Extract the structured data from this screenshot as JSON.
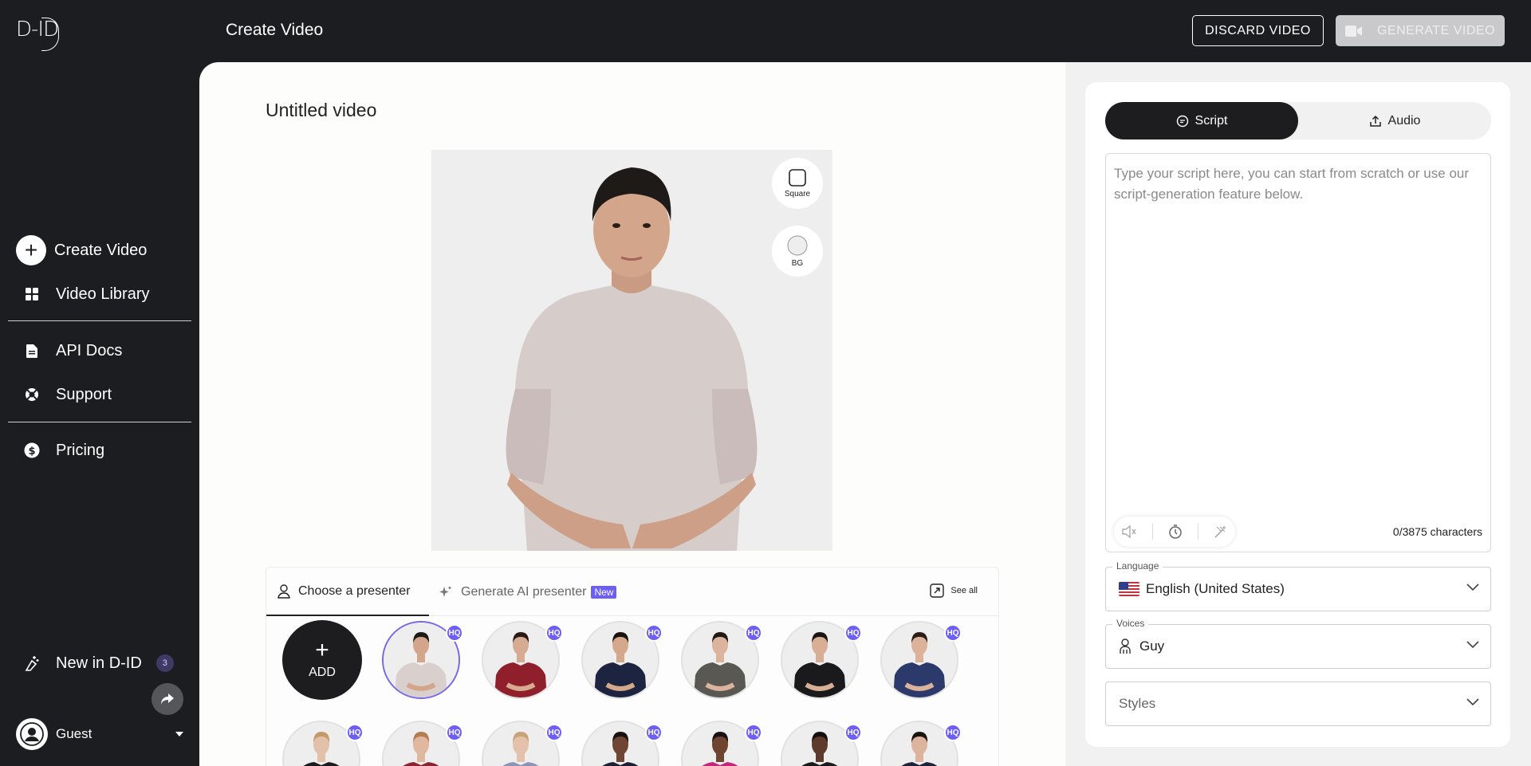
{
  "app": {
    "logo_text": "D-ID",
    "page_title": "Create Video"
  },
  "sidebar": {
    "items": [
      {
        "label": "Create Video",
        "icon": "plus-circle-icon"
      },
      {
        "label": "Video Library",
        "icon": "grid-icon"
      },
      {
        "label": "API Docs",
        "icon": "document-icon"
      },
      {
        "label": "Support",
        "icon": "lifebuoy-icon"
      },
      {
        "label": "Pricing",
        "icon": "dollar-icon"
      }
    ],
    "new_in": {
      "label": "New in D-ID",
      "count": "3"
    },
    "user": {
      "name": "Guest"
    }
  },
  "header": {
    "discard_label": "DISCARD VIDEO",
    "generate_label": "GENERATE VIDEO"
  },
  "editor": {
    "video_title": "Untitled video",
    "preview_controls": {
      "square_label": "Square",
      "bg_label": "BG"
    },
    "tabs": {
      "choose": "Choose a presenter",
      "generate": "Generate AI presenter",
      "new_badge": "New",
      "see_all": "See all"
    },
    "add_label": "ADD",
    "presenters": [
      {
        "hq": "HQ",
        "shirt": "#d9cfcd",
        "skin": "#d3a58b",
        "hair": "#1e1a18",
        "selected": true
      },
      {
        "hq": "HQ",
        "shirt": "#8e1f2b",
        "skin": "#d7ab92",
        "hair": "#2a1b14"
      },
      {
        "hq": "HQ",
        "shirt": "#1c2440",
        "skin": "#d5a88c",
        "hair": "#1a1411"
      },
      {
        "hq": "HQ",
        "shirt": "#5a5852",
        "skin": "#dcb49d",
        "hair": "#241a15"
      },
      {
        "hq": "HQ",
        "shirt": "#1a1a1c",
        "skin": "#d8ae95",
        "hair": "#1c1613"
      },
      {
        "hq": "HQ",
        "shirt": "#2c3a6b",
        "skin": "#dcb29a",
        "hair": "#2b1e18"
      },
      {
        "hq": "HQ",
        "shirt": "#1b1b1d",
        "skin": "#e3c0aa",
        "hair": "#c49a68"
      },
      {
        "hq": "HQ",
        "shirt": "#8b2330",
        "skin": "#e0b79f",
        "hair": "#b47e55"
      },
      {
        "hq": "HQ",
        "shirt": "#8d93b5",
        "skin": "#e4c1ab",
        "hair": "#caa27a"
      },
      {
        "hq": "HQ",
        "shirt": "#1d2034",
        "skin": "#6e4633",
        "hair": "#1a1210"
      },
      {
        "hq": "HQ",
        "shirt": "#c2287a",
        "skin": "#6f4532",
        "hair": "#1a1210"
      },
      {
        "hq": "HQ",
        "shirt": "#1a1a1c",
        "skin": "#5e3a2a",
        "hair": "#140e0c"
      },
      {
        "hq": "HQ",
        "shirt": "#1d2238",
        "skin": "#dcb49d",
        "hair": "#1a1411"
      }
    ]
  },
  "script_panel": {
    "tabs": {
      "script": "Script",
      "audio": "Audio"
    },
    "script_value": "",
    "script_placeholder": "Type your script here, you can start from scratch or use our script-generation feature below.",
    "char_count": "0/3875 characters",
    "language": {
      "label": "Language",
      "value": "English (United States)"
    },
    "voices": {
      "label": "Voices",
      "value": "Guy"
    },
    "styles": {
      "placeholder": "Styles"
    }
  },
  "colors": {
    "sidebar_bg": "#1c1d20",
    "accent_purple": "#6d5ff4",
    "selected_ring": "#7468e8"
  }
}
